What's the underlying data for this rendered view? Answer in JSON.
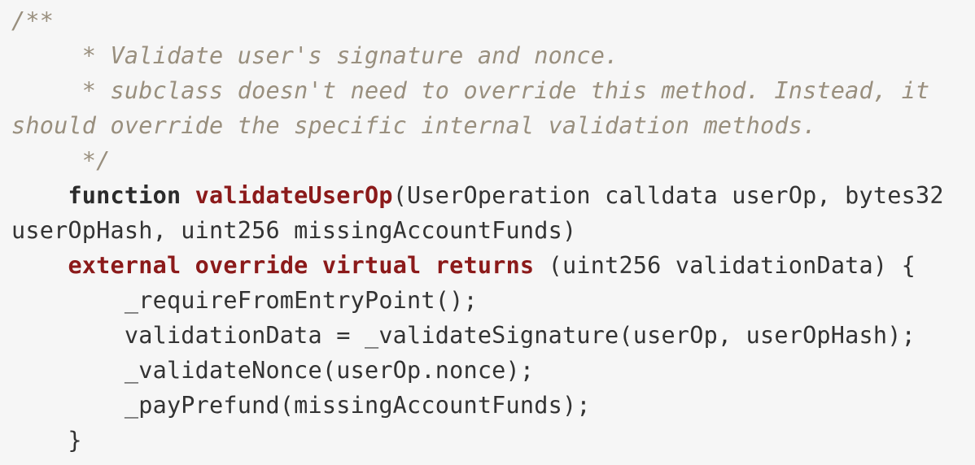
{
  "colors": {
    "background": "#f6f6f6",
    "comment": "#998f7e",
    "keyword": "#2b2b2b",
    "modifier": "#8b1a1a",
    "plain": "#333333"
  },
  "code": {
    "line1": "/**",
    "line2": "     * Validate user's signature and nonce.",
    "line3": "     * subclass doesn't need to override this method. Instead, it",
    "line4": "should override the specific internal validation methods.",
    "line5": "     */",
    "line6_indent": "    ",
    "line6_keyword": "function",
    "line6_space": " ",
    "line6_name": "validateUserOp",
    "line6_rest": "(UserOperation calldata userOp, bytes32",
    "line7": "userOpHash, uint256 missingAccountFunds)",
    "line8_indent": "    ",
    "line8_external": "external",
    "line8_override": "override",
    "line8_virtual": "virtual",
    "line8_returns": "returns",
    "line8_rest": " (uint256 validationData) {",
    "line9": "        _requireFromEntryPoint();",
    "line10": "        validationData = _validateSignature(userOp, userOpHash);",
    "line11": "        _validateNonce(userOp.nonce);",
    "line12": "        _payPrefund(missingAccountFunds);",
    "line13": "    }"
  }
}
